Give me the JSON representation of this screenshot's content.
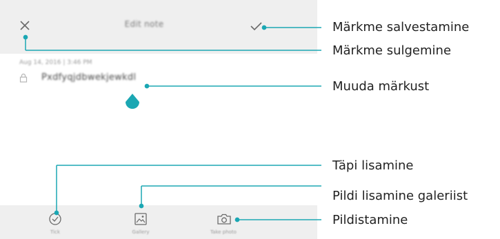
{
  "app": {
    "title": "Edit note",
    "date": "Aug 14, 2016 | 3:46 PM",
    "note_text": "Pxdfyqjdbwekjewkdl",
    "toolbar": {
      "items": [
        {
          "label": "Tick",
          "icon": "checkmark-circle-icon"
        },
        {
          "label": "Gallery",
          "icon": "image-icon"
        },
        {
          "label": "Take photo",
          "icon": "camera-icon"
        }
      ]
    }
  },
  "callouts": {
    "save": "Märkme salvestamine",
    "close": "Märkme sulgemine",
    "edit": "Muuda märkust",
    "add_tick": "Täpi lisamine",
    "add_gallery": "Pildi lisamine galeriist",
    "take_photo": "Pildistamine"
  },
  "colors": {
    "accent": "#1ba7b3",
    "bar_bg": "#efefef"
  }
}
